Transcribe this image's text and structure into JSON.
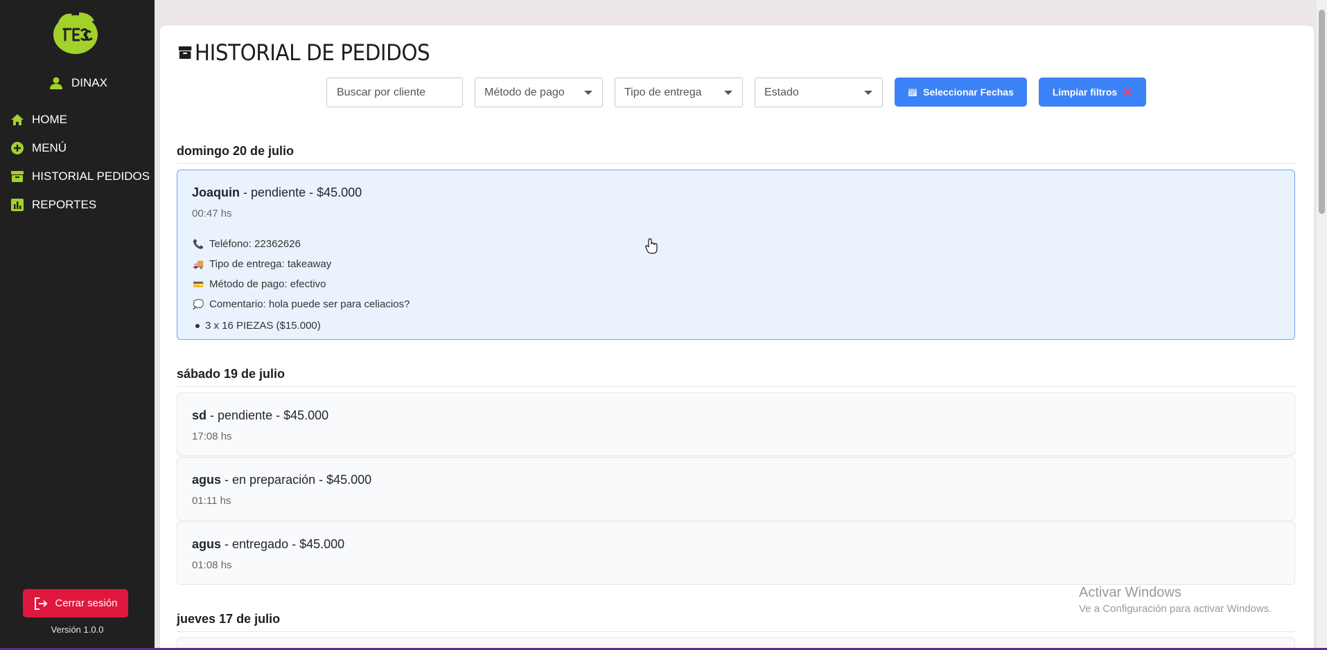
{
  "sidebar": {
    "user": "DINAX",
    "items": [
      {
        "label": "HOME",
        "icon": "home-icon"
      },
      {
        "label": "MENÚ",
        "icon": "plus-circle-icon"
      },
      {
        "label": "HISTORIAL PEDIDOS",
        "icon": "archive-icon"
      },
      {
        "label": "REPORTES",
        "icon": "chart-icon"
      }
    ],
    "logout": "Cerrar sesión",
    "version": "Versión 1.0.0",
    "accent": "#a3d12c"
  },
  "page": {
    "title": "HISTORIAL DE PEDIDOS"
  },
  "filters": {
    "search_placeholder": "Buscar por cliente",
    "payment": "Método de pago",
    "delivery": "Tipo de entrega",
    "status": "Estado",
    "dates_button": "Seleccionar Fechas",
    "clear_button": "Limpiar filtros",
    "button_color": "#3b82f6"
  },
  "groups": [
    {
      "date": "domingo 20 de julio",
      "orders": [
        {
          "client": "Joaquin",
          "summary": " - pendiente - $45.000",
          "time": "00:47 hs",
          "phone": "Teléfono: 22362626",
          "delivery": "Tipo de entrega: takeaway",
          "payment": "Método de pago: efectivo",
          "comment": "Comentario: hola puede ser para celiacios?",
          "item": "3 x 16 PIEZAS ($15.000)"
        }
      ]
    },
    {
      "date": "sábado 19 de julio",
      "orders": [
        {
          "client": "sd",
          "summary": " - pendiente - $45.000",
          "time": "17:08 hs"
        },
        {
          "client": "agus",
          "summary": " - en preparación - $45.000",
          "time": "01:11 hs"
        },
        {
          "client": "agus",
          "summary": " - entregado - $45.000",
          "time": "01:08 hs"
        }
      ]
    },
    {
      "date": "jueves 17 de julio",
      "orders": []
    }
  ],
  "watermark": {
    "line1": "Activar Windows",
    "line2": "Ve a Configuración para activar Windows."
  }
}
